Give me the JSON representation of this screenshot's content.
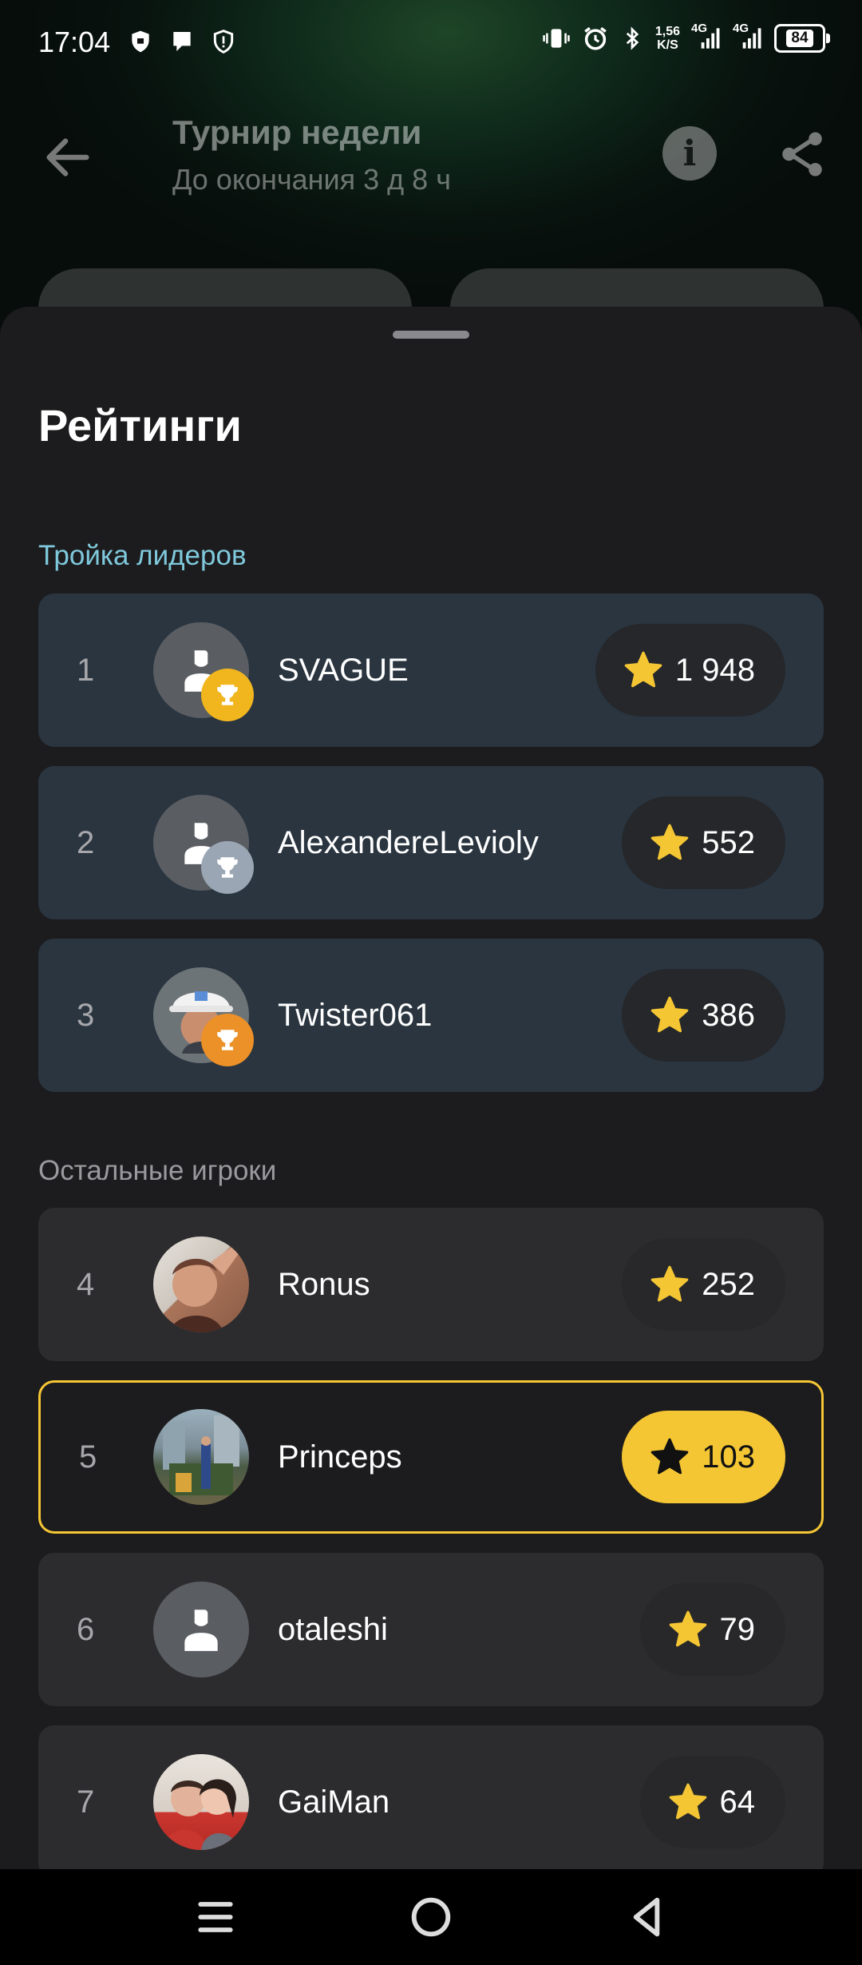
{
  "status_bar": {
    "time": "17:04",
    "net_speed_value": "1,56",
    "net_speed_unit": "K/S",
    "signal1": "4G",
    "signal2": "4G",
    "battery": "84"
  },
  "header": {
    "title": "Турнир недели",
    "subtitle": "До окончания 3 д 8 ч"
  },
  "sheet": {
    "title": "Рейтинги",
    "leaders_label": "Тройка лидеров",
    "others_label": "Остальные игроки"
  },
  "colors": {
    "accent": "#f5c634",
    "leader_row": "#2a3540",
    "other_row": "#2c2c2e",
    "section_top": "#7fc9dc"
  },
  "leaders": [
    {
      "rank": "1",
      "name": "SVAGUE",
      "score": "1 948",
      "trophy": "gold",
      "avatar": "placeholder"
    },
    {
      "rank": "2",
      "name": "AlexandereLevioly",
      "score": "552",
      "trophy": "silver",
      "avatar": "placeholder"
    },
    {
      "rank": "3",
      "name": "Twister061",
      "score": "386",
      "trophy": "bronze",
      "avatar": "photo"
    }
  ],
  "others": [
    {
      "rank": "4",
      "name": "Ronus",
      "score": "252",
      "avatar": "photo"
    },
    {
      "rank": "5",
      "name": "Princeps",
      "score": "103",
      "avatar": "photo",
      "current_user": true
    },
    {
      "rank": "6",
      "name": "otaleshi",
      "score": "79",
      "avatar": "placeholder"
    },
    {
      "rank": "7",
      "name": "GaiMan",
      "score": "64",
      "avatar": "photo"
    }
  ],
  "icons": {
    "back": "arrow-left-icon",
    "info": "info-icon",
    "share": "share-icon",
    "star": "star-icon",
    "trophy": "trophy-icon"
  }
}
